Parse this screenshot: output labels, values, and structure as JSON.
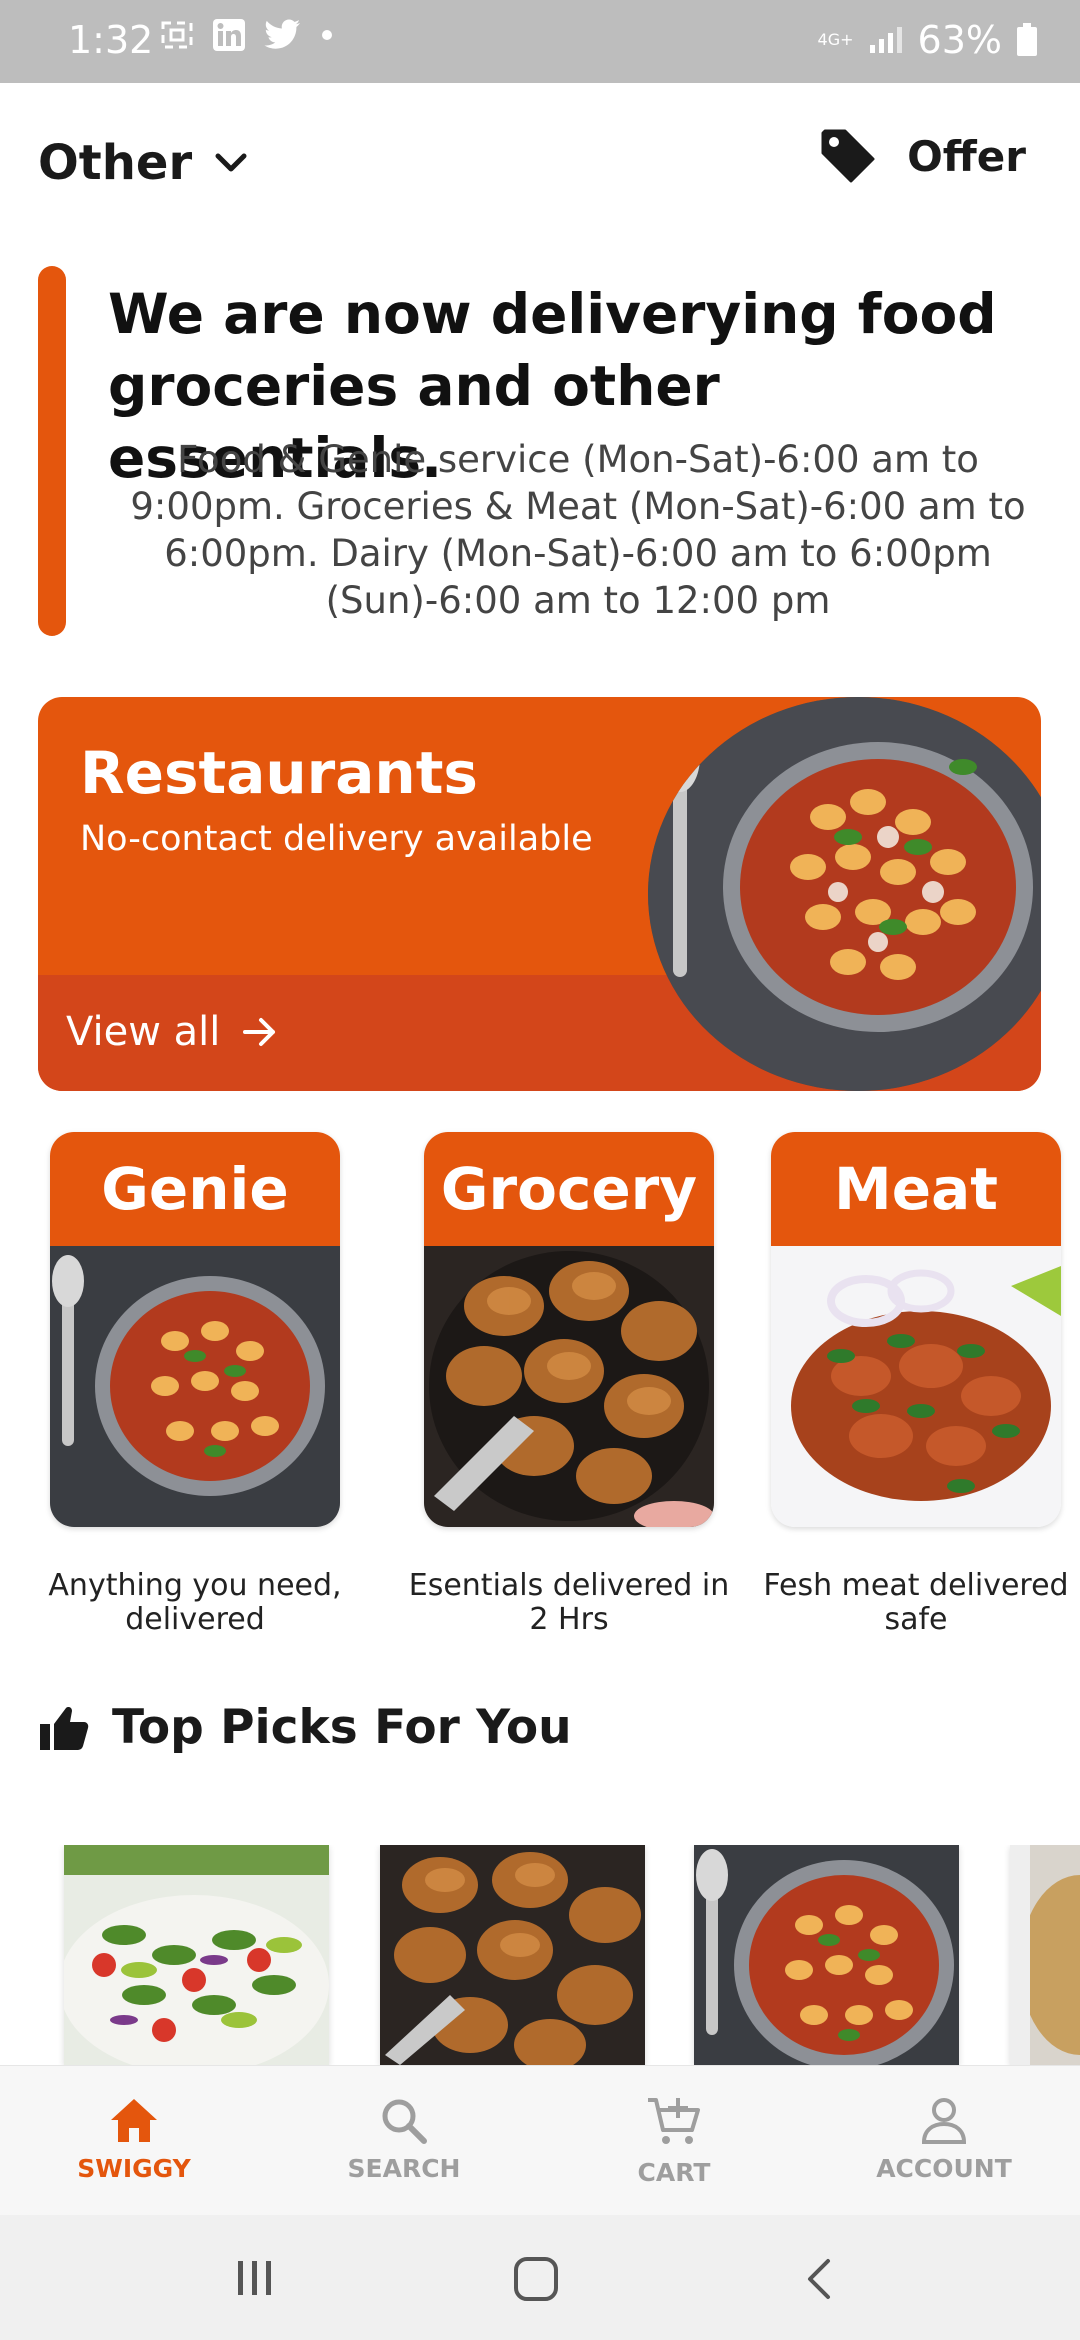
{
  "status_bar": {
    "time": "1:32",
    "battery": "63%",
    "network": "4G+"
  },
  "header": {
    "location": "Other",
    "offer_label": "Offer"
  },
  "notice": {
    "title": "We are now deliverying food groceries and other essentials.",
    "body": "Food & Genie service (Mon-Sat)-6:00 am to 9:00pm. Groceries & Meat (Mon-Sat)-6:00 am to 6:00pm. Dairy (Mon-Sat)-6:00 am to 6:00pm (Sun)-6:00 am to 12:00 pm"
  },
  "restaurants": {
    "title": "Restaurants",
    "subtitle": "No-contact delivery available",
    "view_all": "View all"
  },
  "categories": [
    {
      "label": "Genie",
      "description": "Anything you need, delivered"
    },
    {
      "label": "Grocery",
      "description": "Esentials delivered in 2 Hrs"
    },
    {
      "label": "Meat",
      "description": "Fesh meat delivered safe"
    }
  ],
  "top_picks": {
    "title": "Top Picks For You"
  },
  "bottom_nav": [
    {
      "label": "SWIGGY",
      "icon": "home-icon",
      "active": true
    },
    {
      "label": "SEARCH",
      "icon": "search-icon",
      "active": false
    },
    {
      "label": "CART",
      "icon": "cart-icon",
      "active": false
    },
    {
      "label": "ACCOUNT",
      "icon": "account-icon",
      "active": false
    }
  ],
  "colors": {
    "accent": "#e4560d",
    "accent_dark": "#d3461a",
    "inactive": "#9e9e9e"
  }
}
